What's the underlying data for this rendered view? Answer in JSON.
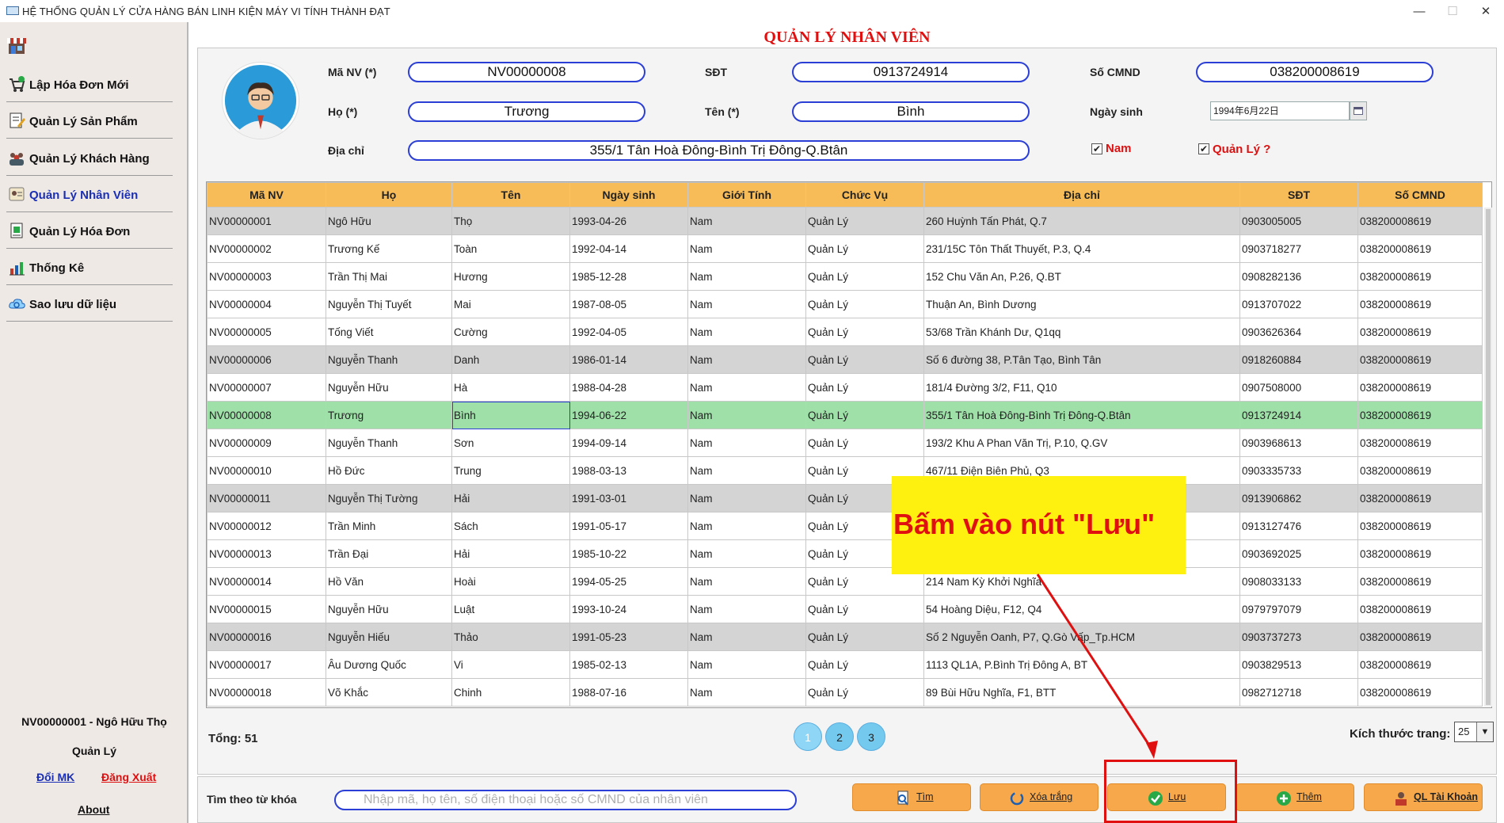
{
  "window": {
    "title": "HỆ THỐNG QUẢN LÝ CỬA HÀNG BÁN LINH KIỆN MÁY VI TÍNH THÀNH ĐẠT",
    "minimize": "—",
    "maximize": "☐",
    "close": "✕"
  },
  "sidebar": {
    "items": [
      {
        "label": "Lập Hóa Đơn Mới",
        "icon": "cart-add-icon"
      },
      {
        "label": "Quản Lý Sản Phẩm",
        "icon": "edit-document-icon"
      },
      {
        "label": "Quản Lý Khách Hàng",
        "icon": "customers-group-icon"
      },
      {
        "label": "Quản Lý Nhân Viên",
        "icon": "employee-id-icon",
        "active": true
      },
      {
        "label": "Quản Lý Hóa Đơn",
        "icon": "invoice-money-icon"
      },
      {
        "label": "Thống Kê",
        "icon": "bar-chart-icon"
      },
      {
        "label": "Sao lưu dữ liệu",
        "icon": "cloud-backup-icon"
      }
    ],
    "user": "NV00000001 - Ngô Hữu  Thọ",
    "role": "Quản Lý",
    "change_password": "Đổi MK",
    "logout": "Đăng Xuất",
    "about": "About"
  },
  "page_title": "QUẢN LÝ NHÂN VIÊN",
  "form": {
    "employee_id_label": "Mã NV (*)",
    "employee_id": "NV00000008",
    "phone_label": "SĐT",
    "phone": "0913724914",
    "id_card_label": "Số CMND",
    "id_card": "038200008619",
    "last_name_label": "Họ (*)",
    "last_name": "Trương",
    "first_name_label": "Tên (*)",
    "first_name": "Bình",
    "dob_label": "Ngày sinh",
    "dob": "1994年6月22日",
    "address_label": "Địa chỉ",
    "address": "355/1 Tân Hoà Đông-Bình Trị Đông-Q.Btân",
    "male_label": "Nam",
    "male_checked": true,
    "manager_label": "Quản Lý ?",
    "manager_checked": true
  },
  "table": {
    "columns": [
      "Mã NV",
      "Họ",
      "Tên",
      "Ngày sinh",
      "Giới Tính",
      "Chức Vụ",
      "Địa chỉ",
      "SĐT",
      "Số CMND"
    ],
    "selected_row": 7,
    "gray_rows": [
      0,
      5,
      10,
      15
    ],
    "rows": [
      [
        "NV00000001",
        "Ngô Hữu",
        "Thọ",
        "1993-04-26",
        "Nam",
        "Quản Lý",
        "260 Huỳnh Tấn Phát, Q.7",
        "0903005005",
        "038200008619"
      ],
      [
        "NV00000002",
        "Trương Kế",
        "Toàn",
        "1992-04-14",
        "Nam",
        "Quản Lý",
        "231/15C Tôn Thất Thuyết, P.3, Q.4",
        "0903718277",
        "038200008619"
      ],
      [
        "NV00000003",
        "Trần Thị Mai",
        "Hương",
        "1985-12-28",
        "Nam",
        "Quản Lý",
        "152 Chu Văn An, P.26, Q.BT",
        "0908282136",
        "038200008619"
      ],
      [
        "NV00000004",
        "Nguyễn Thị Tuyết",
        "Mai",
        "1987-08-05",
        "Nam",
        "Quản Lý",
        "Thuận An, Bình Dương",
        "0913707022",
        "038200008619"
      ],
      [
        "NV00000005",
        "Tống Viết",
        "Cường",
        "1992-04-05",
        "Nam",
        "Quản Lý",
        "53/68 Trần Khánh Dư, Q1qq",
        "0903626364",
        "038200008619"
      ],
      [
        "NV00000006",
        "Nguyễn Thanh",
        "Danh",
        "1986-01-14",
        "Nam",
        "Quản Lý",
        "Số 6 đường 38, P.Tân Tạo, Bình Tân",
        "0918260884",
        "038200008619"
      ],
      [
        "NV00000007",
        "Nguyễn Hữu",
        "Hà",
        "1988-04-28",
        "Nam",
        "Quản Lý",
        "181/4 Đường 3/2, F11, Q10",
        "0907508000",
        "038200008619"
      ],
      [
        "NV00000008",
        "Trương",
        "Bình",
        "1994-06-22",
        "Nam",
        "Quản Lý",
        "355/1 Tân Hoà Đông-Bình Trị Đông-Q.Btân",
        "0913724914",
        "038200008619"
      ],
      [
        "NV00000009",
        "Nguyễn Thanh",
        "Sơn",
        "1994-09-14",
        "Nam",
        "Quản Lý",
        "193/2 Khu A Phan Văn Trị, P.10, Q.GV",
        "0903968613",
        "038200008619"
      ],
      [
        "NV00000010",
        "Hồ Đức",
        "Trung",
        "1988-03-13",
        "Nam",
        "Quản Lý",
        "467/11 Điện Biên Phủ, Q3",
        "0903335733",
        "038200008619"
      ],
      [
        "NV00000011",
        "Nguyễn Thị Tường",
        "Hải",
        "1991-03-01",
        "Nam",
        "Quản Lý",
        "",
        "0913906862",
        "038200008619"
      ],
      [
        "NV00000012",
        "Trần Minh",
        "Sách",
        "1991-05-17",
        "Nam",
        "Quản Lý",
        "",
        "0913127476",
        "038200008619"
      ],
      [
        "NV00000013",
        "Trần Đại",
        "Hải",
        "1985-10-22",
        "Nam",
        "Quản Lý",
        "",
        "0903692025",
        "038200008619"
      ],
      [
        "NV00000014",
        "Hồ Văn",
        "Hoài",
        "1994-05-25",
        "Nam",
        "Quản Lý",
        "214 Nam Kỳ Khởi Nghĩa",
        "0908033133",
        "038200008619"
      ],
      [
        "NV00000015",
        "Nguyễn Hữu",
        "Luật",
        "1993-10-24",
        "Nam",
        "Quản Lý",
        "54 Hoàng Diệu, F12, Q4",
        "0979797079",
        "038200008619"
      ],
      [
        "NV00000016",
        "Nguyễn Hiếu",
        "Thảo",
        "1991-05-23",
        "Nam",
        "Quản Lý",
        "Số 2 Nguyễn Oanh, P7, Q.Gò Vấp_Tp.HCM",
        "0903737273",
        "038200008619"
      ],
      [
        "NV00000017",
        "Âu Dương Quốc",
        "Vi",
        "1985-02-13",
        "Nam",
        "Quản Lý",
        "1113 QL1A, P.Bình Trị Đông A, BT",
        "0903829513",
        "038200008619"
      ],
      [
        "NV00000018",
        "Võ Khắc",
        "Chinh",
        "1988-07-16",
        "Nam",
        "Quản Lý",
        "89 Bùi Hữu Nghĩa, F1, BTT",
        "0982712718",
        "038200008619"
      ]
    ]
  },
  "pagination": {
    "total": "Tổng: 51",
    "pages": [
      "1",
      "2",
      "3"
    ],
    "current": "1",
    "page_size_label": "Kích thước trang:",
    "page_size": "25"
  },
  "search": {
    "label": "Tìm theo từ khóa",
    "placeholder": "Nhập mã, họ tên, số điện thoại hoặc số CMND của nhân viên"
  },
  "actions": {
    "search": "Tìm",
    "clear": "Xóa trắng",
    "save": "Lưu",
    "add": "Thêm",
    "accounts": "QL Tài Khoản"
  },
  "annotation": {
    "callout": "Bấm vào nút \"Lưu\"",
    "color": "#e01010",
    "callout_bg": "#fff10f"
  }
}
